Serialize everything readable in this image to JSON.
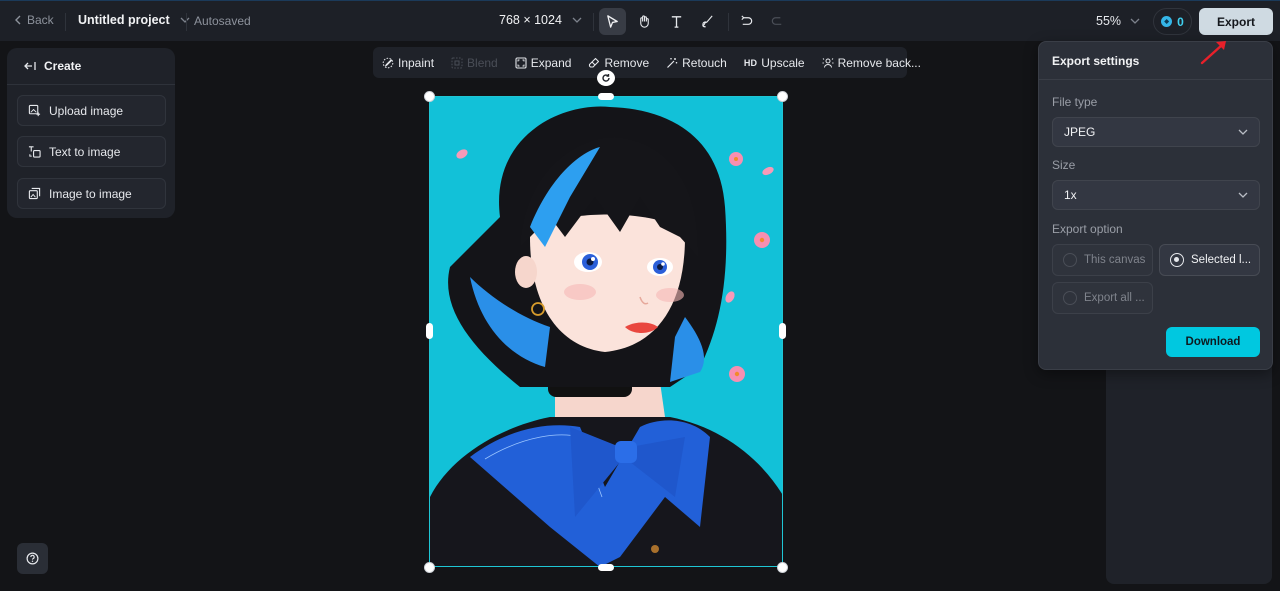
{
  "topbar": {
    "back_label": "Back",
    "project_title": "Untitled project",
    "autosave_status": "Autosaved",
    "canvas_size": "768 × 1024",
    "tools": [
      {
        "name": "select",
        "active": true
      },
      {
        "name": "hand",
        "active": false
      },
      {
        "name": "text",
        "active": false
      },
      {
        "name": "brush",
        "active": false
      },
      {
        "name": "undo",
        "active": false
      },
      {
        "name": "redo",
        "active": false,
        "disabled": true
      }
    ],
    "zoom_level": "55%",
    "credits": "0",
    "export_label": "Export"
  },
  "left_panel": {
    "header": "Create",
    "items": [
      {
        "label": "Upload image",
        "icon": "upload-image-icon"
      },
      {
        "label": "Text to image",
        "icon": "text-to-image-icon"
      },
      {
        "label": "Image to image",
        "icon": "image-to-image-icon"
      }
    ]
  },
  "edit_toolbar": {
    "items": [
      {
        "label": "Inpaint",
        "icon": "inpaint-icon",
        "disabled": false
      },
      {
        "label": "Blend",
        "icon": "blend-icon",
        "disabled": true
      },
      {
        "label": "Expand",
        "icon": "expand-icon",
        "disabled": false
      },
      {
        "label": "Remove",
        "icon": "eraser-icon",
        "disabled": false
      },
      {
        "label": "Retouch",
        "icon": "magic-wand-icon",
        "disabled": false
      },
      {
        "label": "Upscale",
        "icon": "hd-icon",
        "icon_text": "HD",
        "disabled": false
      },
      {
        "label": "Remove back...",
        "icon": "remove-background-icon",
        "disabled": false
      }
    ]
  },
  "canvas": {
    "image_description": "Anime illustration of a girl with black and blue bob haircut, blue sailor collar with bow, on cyan background with pink petals",
    "background_color": "#13c2d8",
    "selection_color": "#1fc6d4"
  },
  "export_popup": {
    "title": "Export settings",
    "file_type_label": "File type",
    "file_type_value": "JPEG",
    "size_label": "Size",
    "size_value": "1x",
    "export_option_label": "Export option",
    "options": [
      {
        "label": "This canvas",
        "selected": false
      },
      {
        "label": "Selected l...",
        "selected": true
      },
      {
        "label": "Export all ...",
        "selected": false
      }
    ],
    "download_label": "Download"
  },
  "colors": {
    "accent": "#00c8e0",
    "export_button": "#cfdae2",
    "annotation_arrow": "#e8202a"
  }
}
